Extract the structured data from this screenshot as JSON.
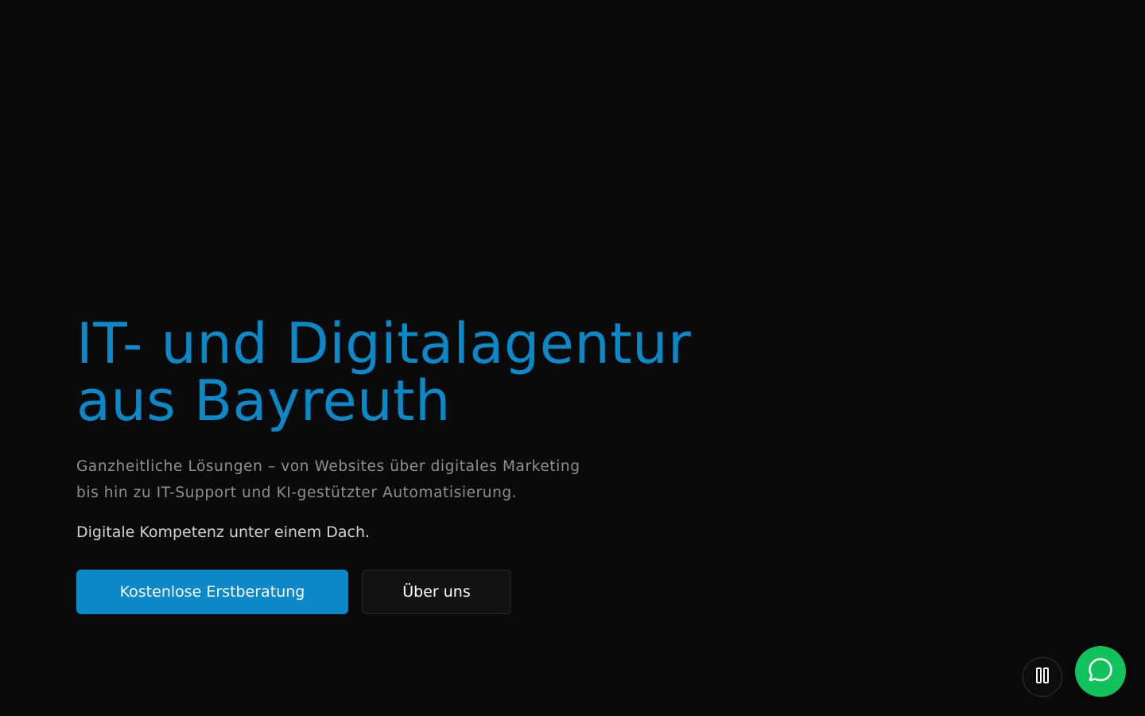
{
  "hero": {
    "title_line1": "IT- und Digitalagentur",
    "title_line2": "aus Bayreuth",
    "subtitle_line1": "Ganzheitliche Lösungen – von Websites über digitales Marketing",
    "subtitle_line2": "bis hin zu IT-Support und KI-gestützter Automatisierung.",
    "tagline": "Digitale Kompetenz unter einem Dach."
  },
  "cta": {
    "primary_label": "Kostenlose Erstberatung",
    "secondary_label": "Über uns"
  },
  "floating": {
    "pause_icon": "pause-icon",
    "chat_icon": "chat-bubble-icon"
  },
  "colors": {
    "background": "#0a0a0a",
    "accent": "#0a88c8",
    "chat_green": "#11c15a"
  }
}
